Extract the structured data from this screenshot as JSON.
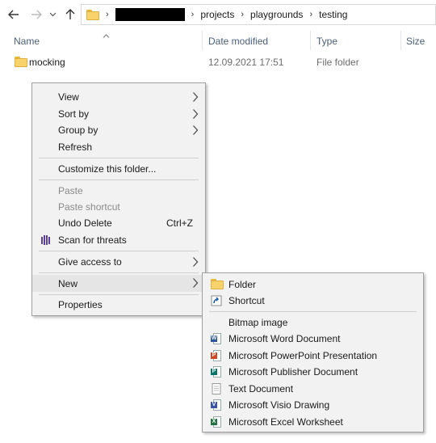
{
  "address_bar": {
    "segments": [
      "projects",
      "playgrounds",
      "testing"
    ]
  },
  "columns": {
    "name": "Name",
    "date_modified": "Date modified",
    "type": "Type",
    "size": "Size"
  },
  "files": [
    {
      "name": "mocking",
      "date": "12.09.2021 17:51",
      "type": "File folder"
    }
  ],
  "context_menu": {
    "view": "View",
    "sort_by": "Sort by",
    "group_by": "Group by",
    "refresh": "Refresh",
    "customize": "Customize this folder...",
    "paste": "Paste",
    "paste_shortcut": "Paste shortcut",
    "undo_delete": "Undo Delete",
    "undo_shortcut": "Ctrl+Z",
    "scan": "Scan for threats",
    "give_access": "Give access to",
    "new": "New",
    "properties": "Properties"
  },
  "new_submenu": {
    "folder": "Folder",
    "shortcut": "Shortcut",
    "bitmap": "Bitmap image",
    "word": "Microsoft Word Document",
    "powerpoint": "Microsoft PowerPoint Presentation",
    "publisher": "Microsoft Publisher Document",
    "text": "Text Document",
    "visio": "Microsoft Visio Drawing",
    "excel": "Microsoft Excel Worksheet"
  },
  "colors": {
    "menu_bg": "#f2f2f2",
    "header_text": "#4c607a",
    "highlight": "#e5e5e5",
    "word": "#2b579a",
    "powerpoint": "#d24726",
    "publisher": "#077568",
    "visio": "#3955a3",
    "excel": "#217346",
    "scan": "#5b3f9a"
  }
}
